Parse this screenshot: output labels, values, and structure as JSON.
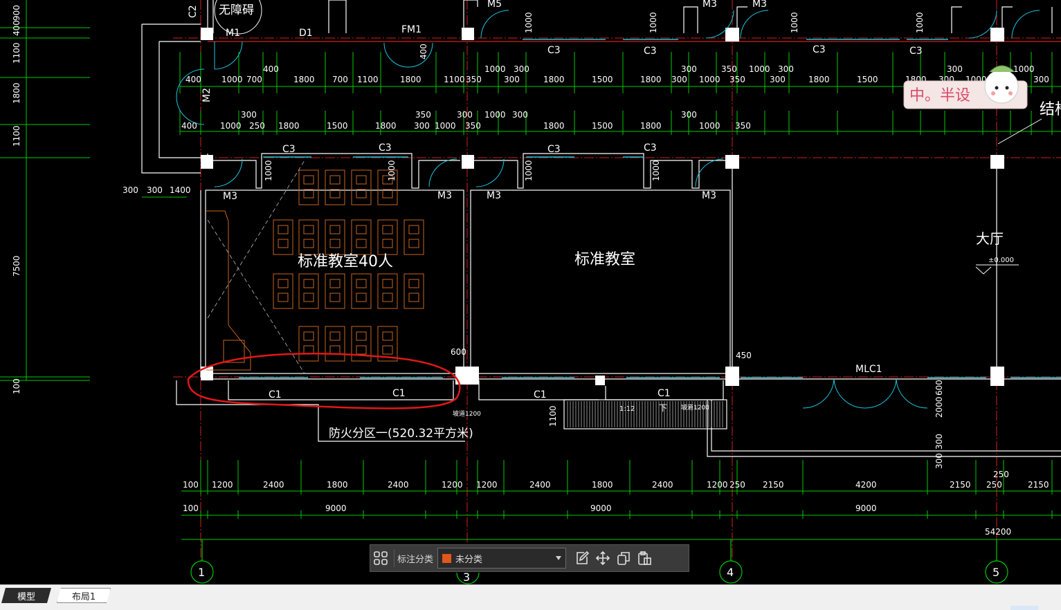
{
  "colors": {
    "axis": "#d32020",
    "dim": "#00cc00",
    "wall": "#ffffff",
    "door": "#19c8e0",
    "furniture": "#c8661e",
    "swatch": "#e0581b"
  },
  "labels": {
    "barrier_free": "无障碍",
    "fire_zone": "防火分区一(520.32平方米)",
    "classroom_40": "标准教室40人",
    "classroom": "标准教室",
    "hall": "大厅",
    "elevation": "±0.000",
    "struct_fragment": "结构",
    "ramp_slope": "1:12",
    "ramp_a": "坡道1200",
    "ramp_b": "坡道1200",
    "down": "下",
    "mlc": "MLC1"
  },
  "door_labels": [
    "M1",
    "FM1",
    "M2",
    "M3",
    "M3",
    "M3",
    "M3",
    "M3",
    "M3",
    "M5",
    "D1"
  ],
  "window_labels": [
    "C3",
    "C3",
    "C3",
    "C3",
    "C3",
    "C3",
    "C3",
    "C3",
    "C1",
    "C1",
    "C1",
    "C1",
    "C2"
  ],
  "axes": [
    "1",
    "3",
    "4",
    "5"
  ],
  "dims": {
    "top_row1": [
      "400",
      "1000",
      "700",
      "1800",
      "700",
      "1100",
      "1800",
      "1100",
      "350",
      "1000",
      "300",
      "300",
      "1800",
      "1500",
      "1800",
      "300",
      "300",
      "1000",
      "350",
      "350",
      "1000",
      "300",
      "300",
      "1800",
      "1500",
      "1800",
      "300",
      "1000",
      "300",
      "1000",
      "300"
    ],
    "top_row2": [
      "300",
      "400",
      "1000",
      "250",
      "1800",
      "1500",
      "1800",
      "300",
      "1000",
      "350",
      "300",
      "350",
      "1000",
      "300",
      "1800",
      "1500",
      "1800",
      "300",
      "1000",
      "350",
      "300"
    ],
    "left_vertical": [
      "900",
      "400",
      "1100",
      "1800",
      "1100",
      "7500",
      "100"
    ],
    "left_row": [
      "300",
      "300",
      "1400"
    ],
    "bottom_row1": [
      "100",
      "1200",
      "2400",
      "1800",
      "2400",
      "1200",
      "1200",
      "2400",
      "1800",
      "2400",
      "1200",
      "250",
      "2150",
      "4200",
      "2150",
      "250",
      "2150"
    ],
    "bottom_row2": [
      "100",
      "9000",
      "9000",
      "9000"
    ],
    "total": "54200",
    "misc": [
      "600",
      "450",
      "1000",
      "1000",
      "1000",
      "1000",
      "1000",
      "1000",
      "1000",
      "1000",
      "400",
      "400",
      "2000",
      "600",
      "300",
      "300",
      "1100",
      "250",
      "1800"
    ]
  },
  "watermark": {
    "text": "中。半设"
  },
  "toolbar": {
    "label": "标注分类",
    "category_value": "未分类"
  },
  "tabs": {
    "model": "模型",
    "layout1": "布局1"
  }
}
